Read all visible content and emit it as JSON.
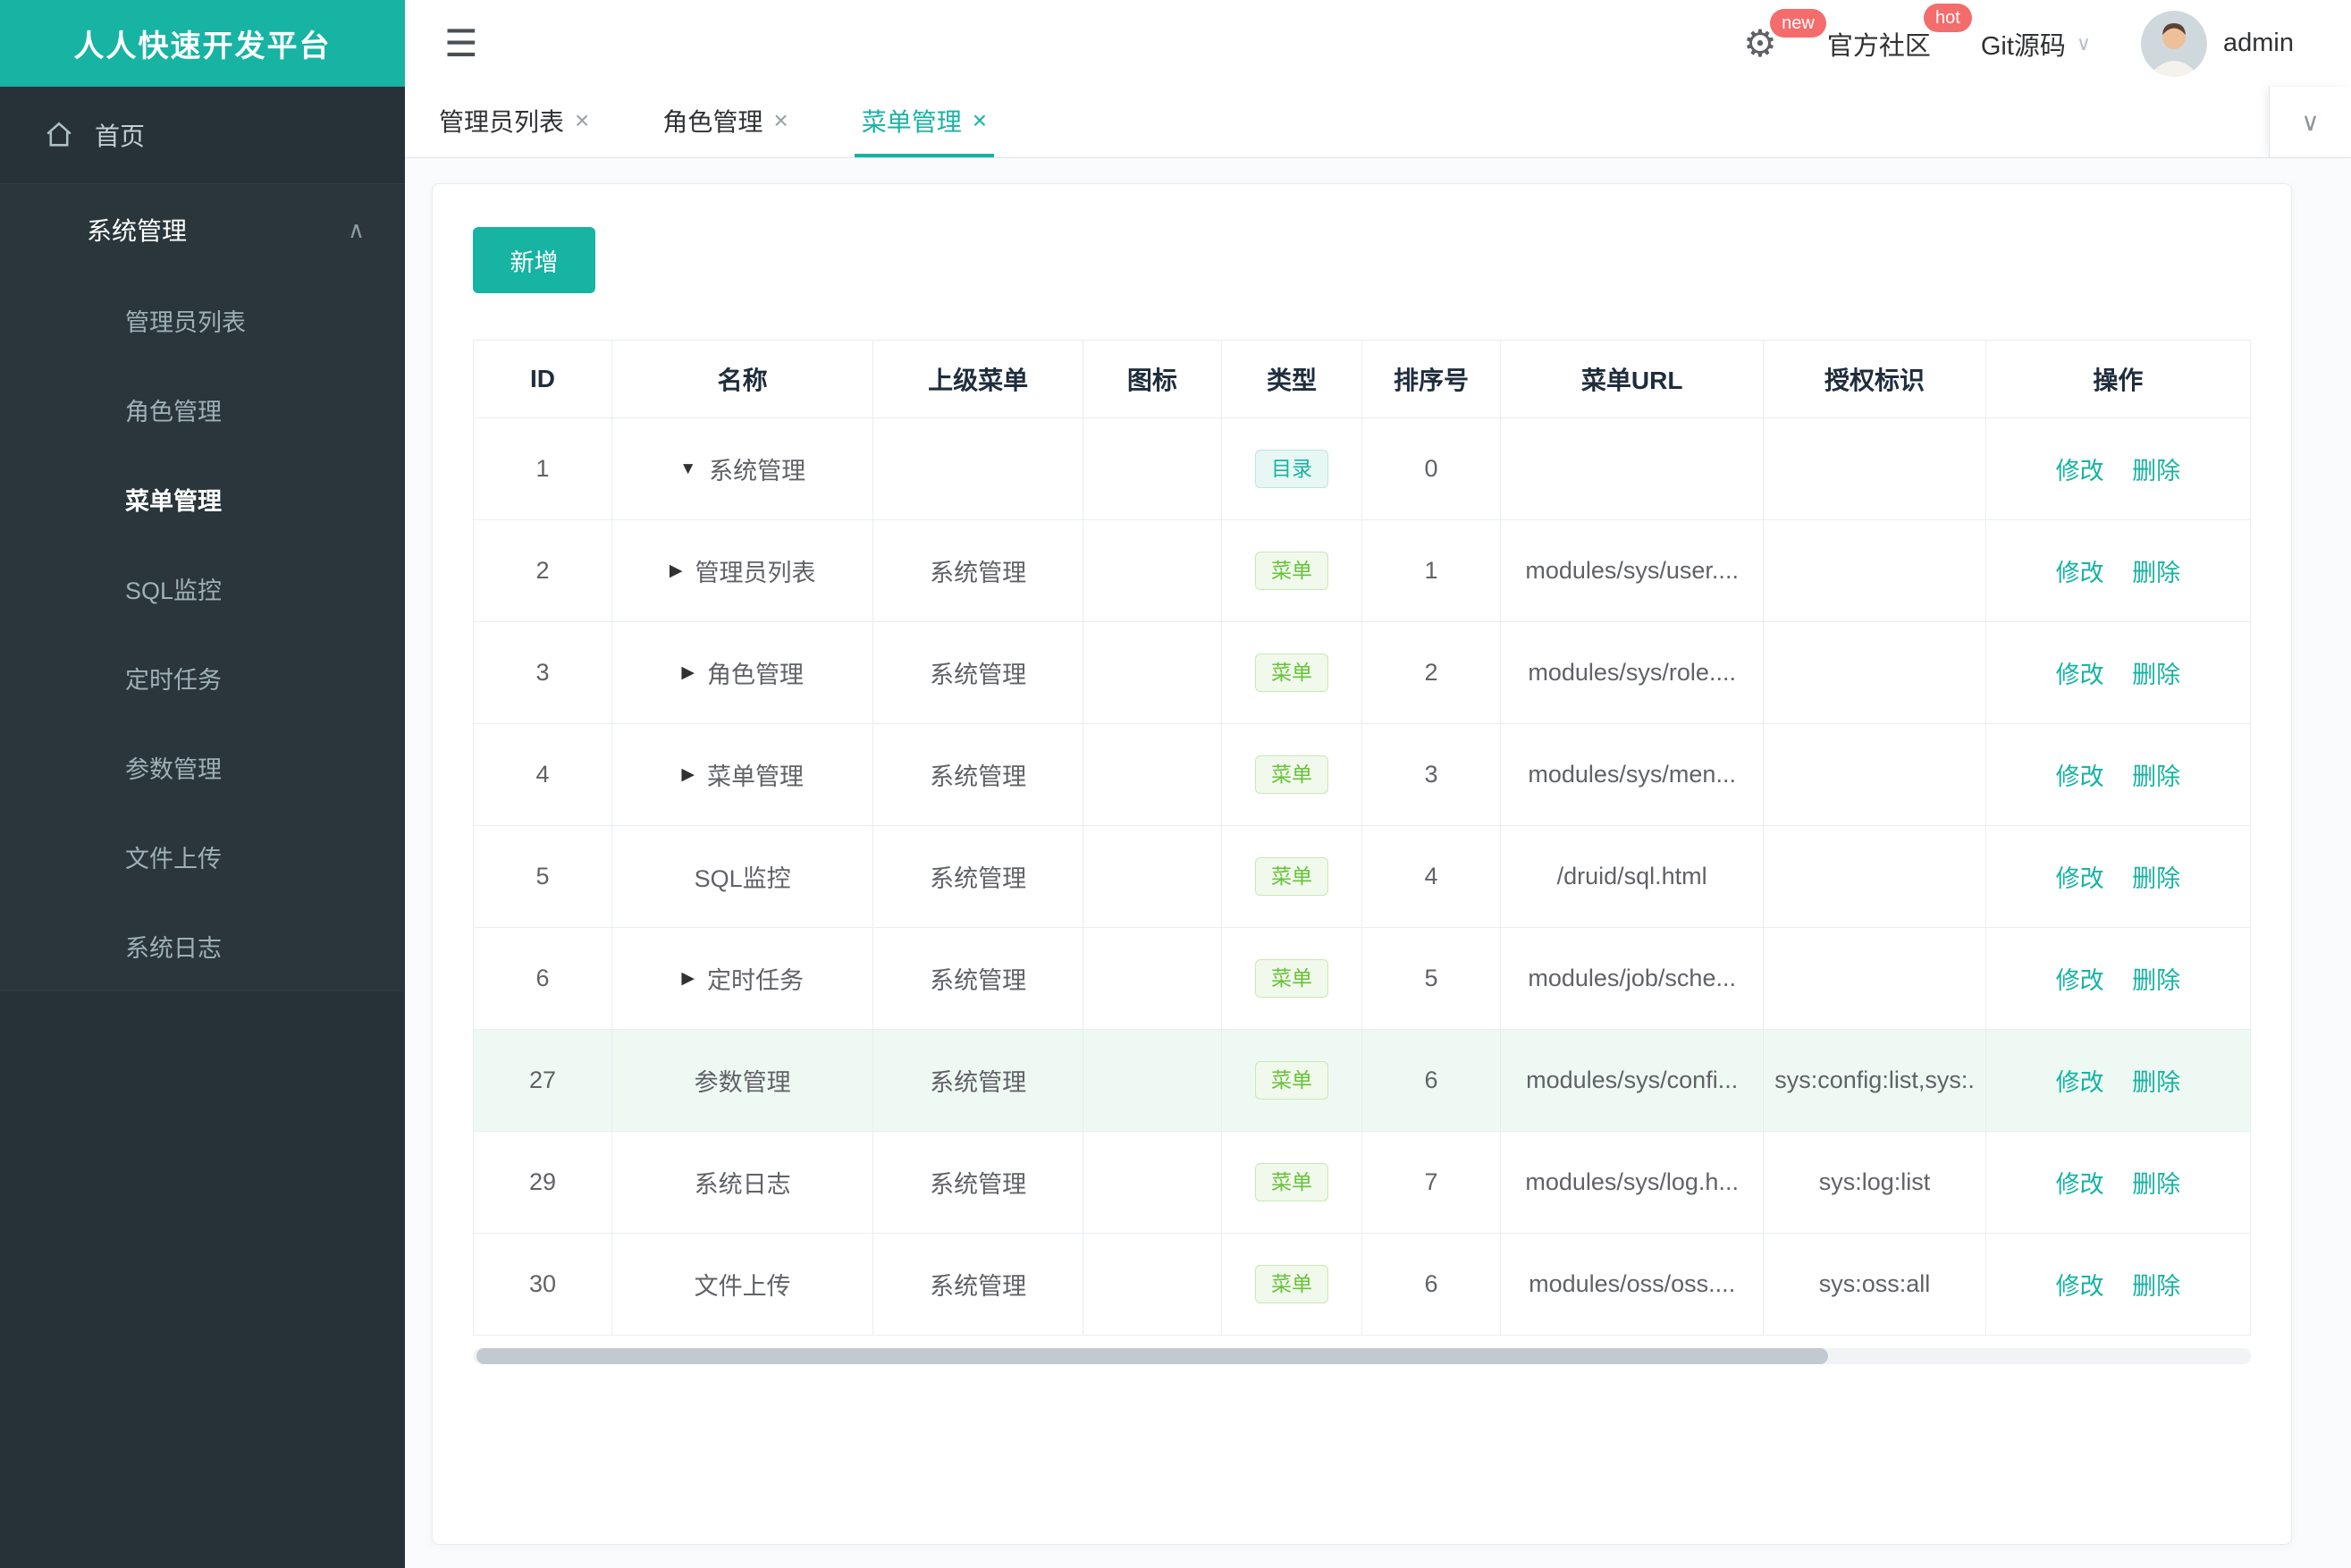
{
  "brand": {
    "title": "人人快速开发平台"
  },
  "colors": {
    "brand_teal": "#17b3a3",
    "sidebar_dark": "#263238",
    "badge_red": "#f56c6c",
    "tag_dir_green": "#17b3a3",
    "tag_menu_green": "#67c23a",
    "row_highlight": "#eef9f4"
  },
  "icons": {
    "hamburger": "☰",
    "gear": "⚙",
    "chevron_down": "∨",
    "chevron_up": "∧",
    "close": "×",
    "home": "⌂"
  },
  "header": {
    "new_badge": "new",
    "hot_badge": "hot",
    "community": "官方社区",
    "git": "Git源码",
    "username": "admin"
  },
  "sidebar": {
    "home_label": "首页",
    "section_label": "系统管理",
    "items": [
      {
        "label": "管理员列表"
      },
      {
        "label": "角色管理"
      },
      {
        "label": "菜单管理"
      },
      {
        "label": "SQL监控"
      },
      {
        "label": "定时任务"
      },
      {
        "label": "参数管理"
      },
      {
        "label": "文件上传"
      },
      {
        "label": "系统日志"
      }
    ]
  },
  "tabs": [
    {
      "label": "管理员列表"
    },
    {
      "label": "角色管理"
    },
    {
      "label": "菜单管理"
    }
  ],
  "toolbar": {
    "add_label": "新增"
  },
  "table": {
    "columns": [
      "ID",
      "名称",
      "上级菜单",
      "图标",
      "类型",
      "排序号",
      "菜单URL",
      "授权标识",
      "操作"
    ],
    "actions": {
      "edit": "修改",
      "delete": "删除"
    },
    "rows": [
      {
        "id": "1",
        "arrow": "▼",
        "name": "系统管理",
        "parent": "",
        "type": "目录",
        "order": "0",
        "url": "",
        "auth": ""
      },
      {
        "id": "2",
        "arrow": "▶",
        "name": "管理员列表",
        "parent": "系统管理",
        "type": "菜单",
        "order": "1",
        "url": "modules/sys/user....",
        "auth": ""
      },
      {
        "id": "3",
        "arrow": "▶",
        "name": "角色管理",
        "parent": "系统管理",
        "type": "菜单",
        "order": "2",
        "url": "modules/sys/role....",
        "auth": ""
      },
      {
        "id": "4",
        "arrow": "▶",
        "name": "菜单管理",
        "parent": "系统管理",
        "type": "菜单",
        "order": "3",
        "url": "modules/sys/men...",
        "auth": ""
      },
      {
        "id": "5",
        "arrow": "",
        "name": "SQL监控",
        "parent": "系统管理",
        "type": "菜单",
        "order": "4",
        "url": "/druid/sql.html",
        "auth": ""
      },
      {
        "id": "6",
        "arrow": "▶",
        "name": "定时任务",
        "parent": "系统管理",
        "type": "菜单",
        "order": "5",
        "url": "modules/job/sche...",
        "auth": ""
      },
      {
        "id": "27",
        "arrow": "",
        "name": "参数管理",
        "parent": "系统管理",
        "type": "菜单",
        "order": "6",
        "url": "modules/sys/confi...",
        "auth": "sys:config:list,sys:."
      },
      {
        "id": "29",
        "arrow": "",
        "name": "系统日志",
        "parent": "系统管理",
        "type": "菜单",
        "order": "7",
        "url": "modules/sys/log.h...",
        "auth": "sys:log:list"
      },
      {
        "id": "30",
        "arrow": "",
        "name": "文件上传",
        "parent": "系统管理",
        "type": "菜单",
        "order": "6",
        "url": "modules/oss/oss....",
        "auth": "sys:oss:all"
      }
    ]
  }
}
